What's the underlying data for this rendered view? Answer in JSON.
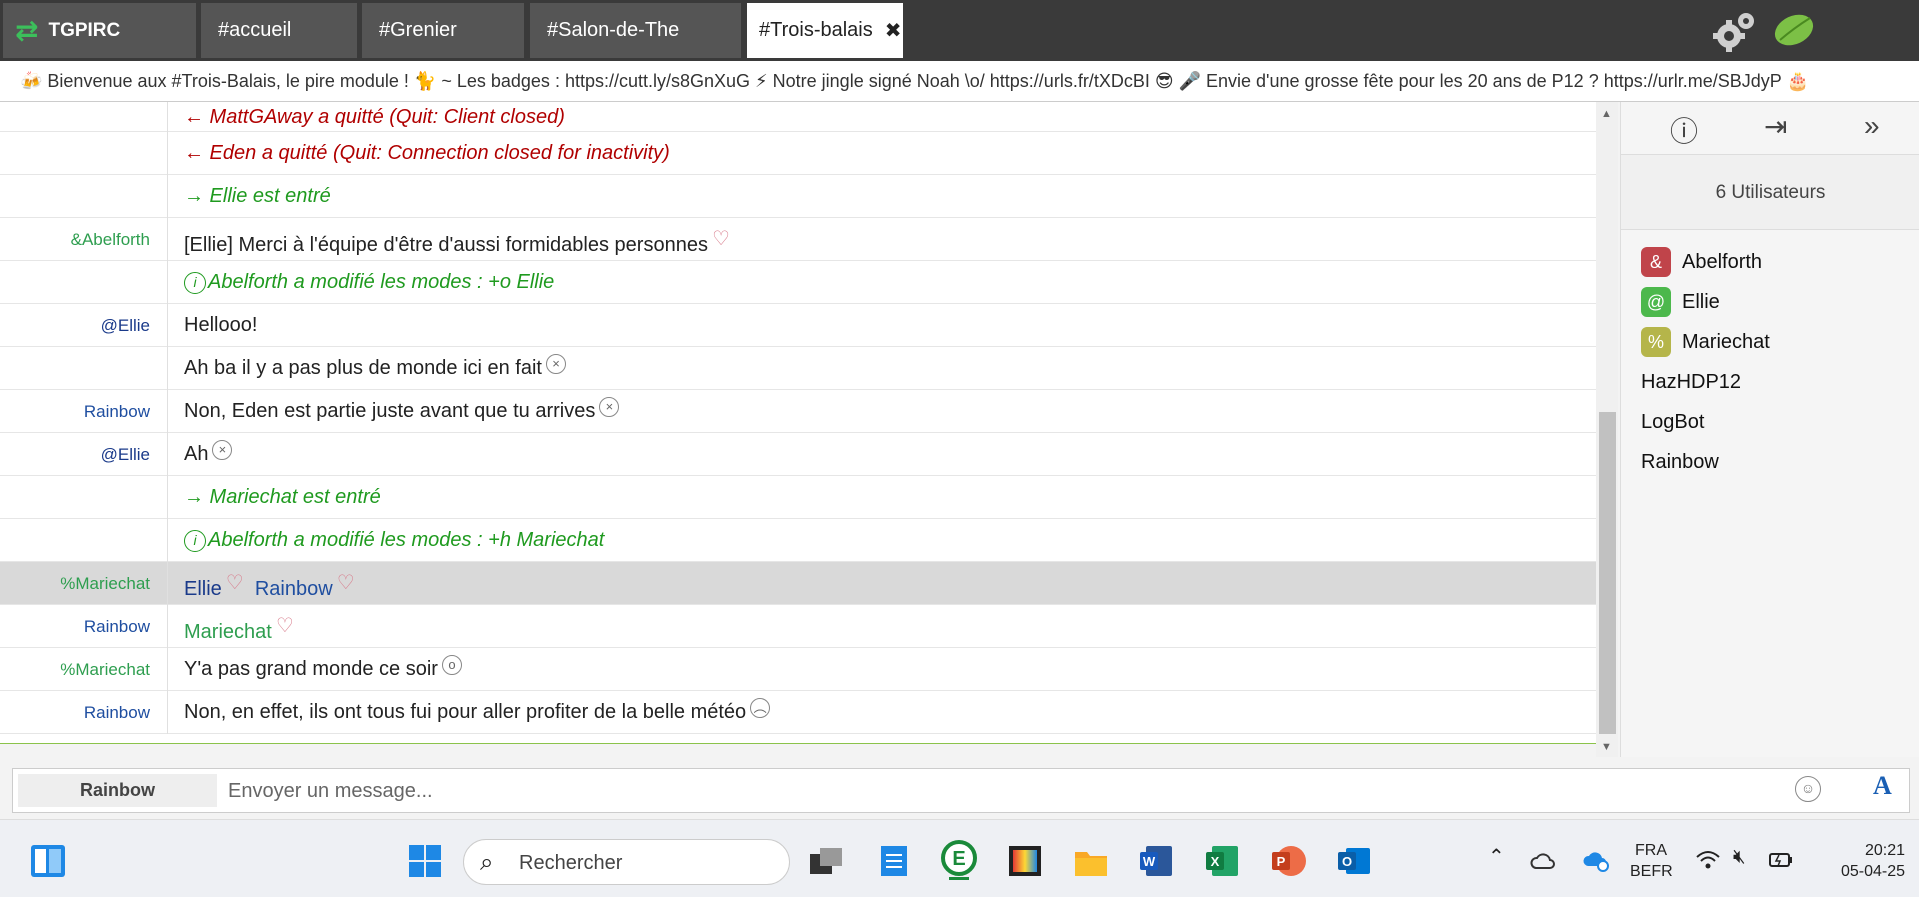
{
  "tabs": {
    "brand": "TGPIRC",
    "items": [
      "#accueil",
      "#Grenier",
      "#Salon-de-The",
      "#Trois-balais"
    ],
    "close_glyph": "✖"
  },
  "topic": "🍻 Bienvenue aux #Trois-Balais, le pire module ! 🐈 ~ Les badges : https://cutt.ly/s8GnXuG ⚡ Notre jingle signé Noah \\o/ https://urls.fr/tXDcBI 😎 🎤 Envie d'une grosse fête pour les 20 ans de P12 ? https://urlr.me/SBJdyP 🎂",
  "messages": [
    {
      "nick": "",
      "text": "← MattGAway a quitté (Quit: Client closed)"
    },
    {
      "nick": "",
      "text": "← Eden a quitté (Quit: Connection closed for inactivity)"
    },
    {
      "nick": "",
      "text": "→ Ellie est entré"
    },
    {
      "nick": "&Abelforth",
      "text": "[Ellie] Merci à l'équipe d'être d'aussi formidables personnes"
    },
    {
      "nick": "",
      "text": "Abelforth a modifié les modes : +o Ellie"
    },
    {
      "nick": "@Ellie",
      "text": "Hellooo!"
    },
    {
      "nick": "",
      "text": "Ah ba il y a pas plus de monde ici en fait"
    },
    {
      "nick": "Rainbow",
      "text": "Non, Eden est partie juste avant que tu arrives"
    },
    {
      "nick": "@Ellie",
      "text": "Ah"
    },
    {
      "nick": "",
      "text": "→ Mariechat est entré"
    },
    {
      "nick": "",
      "text": "Abelforth a modifié les modes : +h Mariechat"
    },
    {
      "nick": "%Mariechat",
      "text": "Ellie",
      "text2": "Rainbow"
    },
    {
      "nick": "Rainbow",
      "text": "Mariechat"
    },
    {
      "nick": "%Mariechat",
      "text": "Y'a pas grand monde ce soir"
    },
    {
      "nick": "Rainbow",
      "text": "Non, en effet, ils ont tous fui pour aller profiter de la belle météo"
    }
  ],
  "users": {
    "count_label": "6 Utilisateurs",
    "list": [
      {
        "prefix": "&",
        "name": "Abelforth",
        "color": "#c0444a"
      },
      {
        "prefix": "@",
        "name": "Ellie",
        "color": "#4cb84c"
      },
      {
        "prefix": "%",
        "name": "Mariechat",
        "color": "#b5b54a"
      },
      {
        "prefix": "",
        "name": "HazHDP12"
      },
      {
        "prefix": "",
        "name": "LogBot"
      },
      {
        "prefix": "",
        "name": "Rainbow"
      }
    ]
  },
  "input": {
    "nick": "Rainbow",
    "placeholder": "Envoyer un message..."
  },
  "taskbar": {
    "search_label": "Rechercher",
    "lang_top": "FRA",
    "lang_bottom": "BEFR",
    "time": "20:21",
    "date": "05-04-25"
  },
  "colors": {
    "quit": "#b00000",
    "join": "#1f9a1f",
    "highlight_row": "#d9d9d9"
  }
}
